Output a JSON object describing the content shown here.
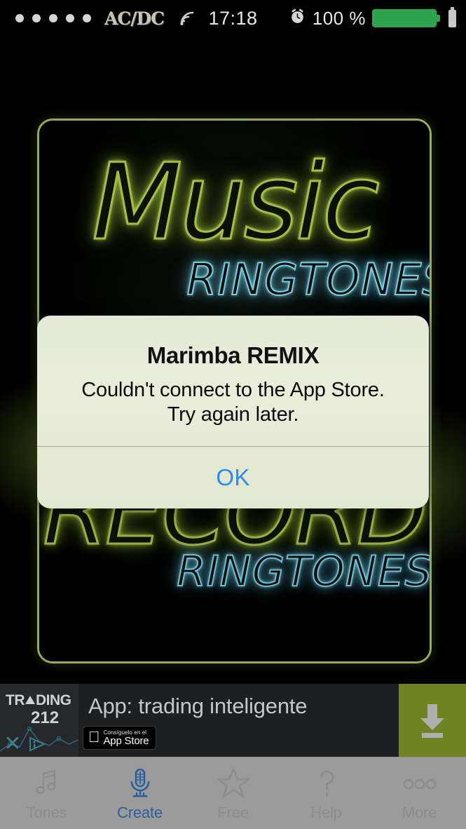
{
  "status_bar": {
    "signal_dots": 5,
    "carrier": "AC/DC",
    "wifi_icon": "wifi-icon",
    "time": "17:18",
    "alarm_icon": "alarm-clock-icon",
    "battery_percent": "100 %",
    "battery_level": 100,
    "battery_color": "#2fa44f"
  },
  "artwork": {
    "line1": "Music",
    "line2": "RINGTONES",
    "line3": "RECORD",
    "line4": "RINGTONES",
    "neon_green": "#aec548",
    "neon_cyan": "#7fd4e8",
    "border_color": "#9cb35a"
  },
  "alert": {
    "title": "Marimba REMIX",
    "message_line1": "Couldn't connect to the App Store.",
    "message_line2": "Try again later.",
    "ok_label": "OK",
    "ok_color": "#2b8cf0",
    "background": "#e7ebd8"
  },
  "ad": {
    "brand_prefix": "TR",
    "brand_suffix": "DING",
    "brand_number": "212",
    "headline": "App: trading inteligente",
    "badge_small": "Consíguelo en el",
    "badge_large": "App Store",
    "apple_icon": "apple-icon",
    "close_icon": "close-icon",
    "info_icon": "ad-choices-icon",
    "cta_icon": "download-icon",
    "cta_color": "#6f8322"
  },
  "tabbar": {
    "background": "#9b9b9b",
    "active_color": "#2b5f9e",
    "inactive_color": "#8c8c8c",
    "items": [
      {
        "label": "Tones",
        "icon": "music-note-icon",
        "active": false
      },
      {
        "label": "Create",
        "icon": "microphone-icon",
        "active": true
      },
      {
        "label": "Free",
        "icon": "star-icon",
        "active": false
      },
      {
        "label": "Help",
        "icon": "question-mark-icon",
        "active": false
      },
      {
        "label": "More",
        "icon": "ellipsis-icon",
        "active": false
      }
    ]
  }
}
